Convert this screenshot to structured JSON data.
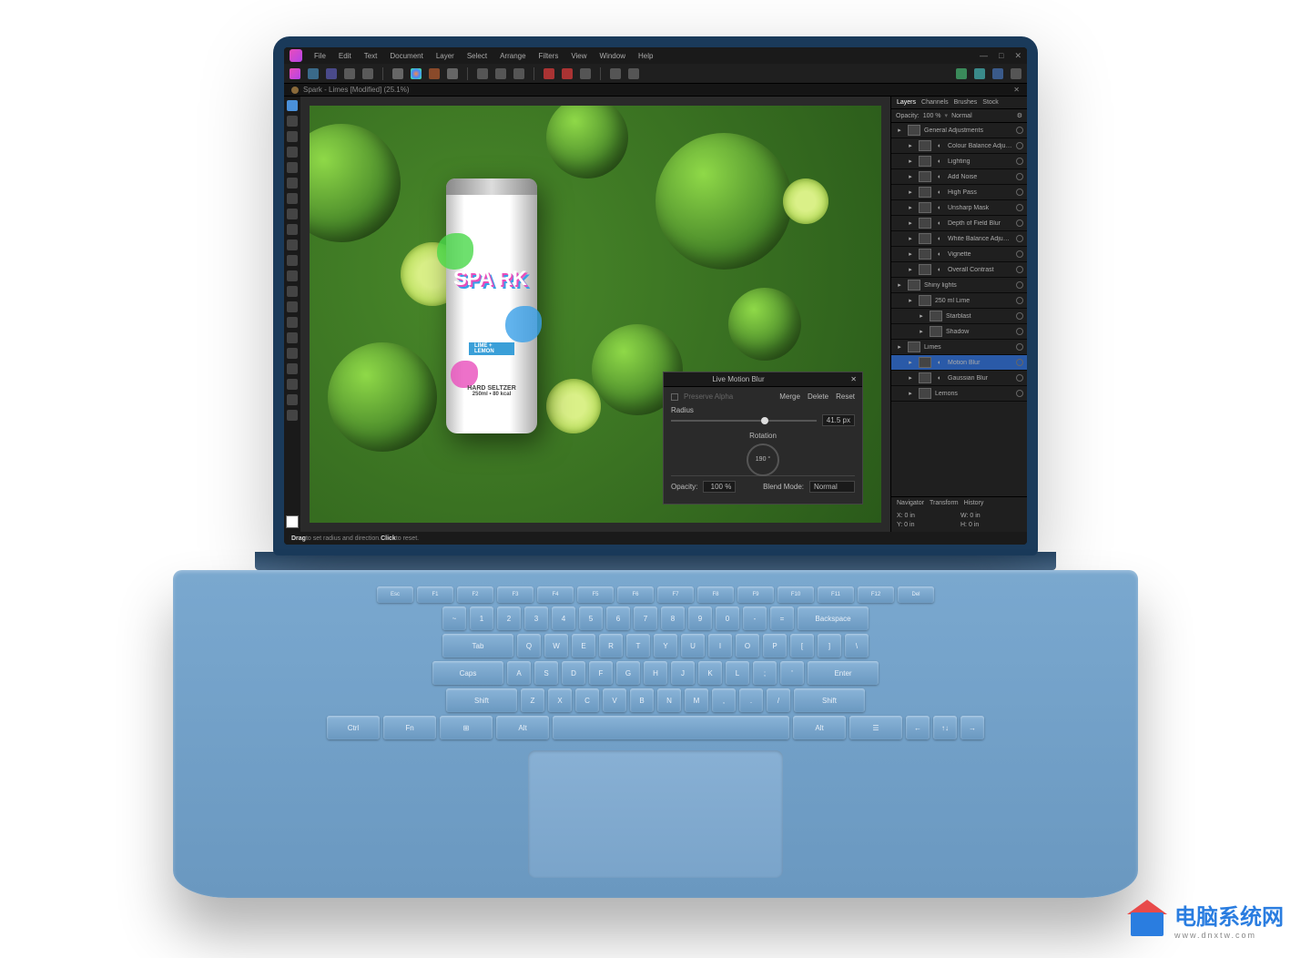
{
  "menubar": [
    "File",
    "Edit",
    "Text",
    "Document",
    "Layer",
    "Select",
    "Arrange",
    "Filters",
    "View",
    "Window",
    "Help"
  ],
  "doc_title": "Spark - Limes [Modified] (25.1%)",
  "panel": {
    "tabs": [
      "Layers",
      "Channels",
      "Brushes",
      "Stock"
    ],
    "opacity_label": "Opacity:",
    "opacity_value": "100 %",
    "blend": "Normal"
  },
  "layers": [
    {
      "name": "General Adjustments",
      "type": "group"
    },
    {
      "name": "Colour Balance Adjustme",
      "type": "adj",
      "indent": 1
    },
    {
      "name": "Lighting",
      "type": "adj",
      "indent": 1
    },
    {
      "name": "Add Noise",
      "type": "adj",
      "indent": 1
    },
    {
      "name": "High Pass",
      "type": "adj",
      "indent": 1
    },
    {
      "name": "Unsharp Mask",
      "type": "adj",
      "indent": 1
    },
    {
      "name": "Depth of Field Blur",
      "type": "adj",
      "indent": 1
    },
    {
      "name": "White Balance Adjustment",
      "type": "adj",
      "indent": 1
    },
    {
      "name": "Vignette",
      "type": "adj",
      "indent": 1
    },
    {
      "name": "Overall Contrast",
      "type": "adj",
      "indent": 1
    },
    {
      "name": "Shiny lights",
      "type": "group"
    },
    {
      "name": "250 ml Lime",
      "type": "img",
      "indent": 1
    },
    {
      "name": "Starblast",
      "type": "img",
      "indent": 2
    },
    {
      "name": "Shadow",
      "type": "fx",
      "indent": 2
    },
    {
      "name": "Limes",
      "type": "group"
    },
    {
      "name": "Motion Blur",
      "type": "adj",
      "indent": 1,
      "selected": true
    },
    {
      "name": "Gaussian Blur",
      "type": "adj",
      "indent": 1
    },
    {
      "name": "Lemons",
      "type": "img",
      "indent": 1
    }
  ],
  "bottom_tabs": [
    "Navigator",
    "Transform",
    "History"
  ],
  "transform": {
    "x": "X: 0 in",
    "y": "Y: 0 in",
    "w": "W: 0 in",
    "h": "H: 0 in"
  },
  "dialog": {
    "title": "Live Motion Blur",
    "preserve": "Preserve Alpha",
    "actions": [
      "Merge",
      "Delete",
      "Reset"
    ],
    "radius_label": "Radius",
    "radius_value": "41.5 px",
    "rotation_label": "Rotation",
    "rotation_value": "190 °",
    "opacity_label": "Opacity:",
    "opacity_value": "100 %",
    "blend_label": "Blend Mode:",
    "blend_value": "Normal"
  },
  "status": {
    "drag": "Drag",
    "drag_txt": " to set radius and direction. ",
    "click": "Click",
    "click_txt": " to reset."
  },
  "can": {
    "brand": "SPA\nRK",
    "tag": "LIME + LEMON",
    "sub": "HARD SELTZER",
    "vol": "250ml • 80 kcal"
  },
  "keyboard": {
    "fn": [
      "Esc",
      "F1",
      "F2",
      "F3",
      "F4",
      "F5",
      "F6",
      "F7",
      "F8",
      "F9",
      "F10",
      "F11",
      "F12",
      "Del"
    ],
    "r1": [
      "~",
      "1",
      "2",
      "3",
      "4",
      "5",
      "6",
      "7",
      "8",
      "9",
      "0",
      "-",
      "=",
      "Backspace"
    ],
    "r2": [
      "Tab",
      "Q",
      "W",
      "E",
      "R",
      "T",
      "Y",
      "U",
      "I",
      "O",
      "P",
      "[",
      "]",
      "\\"
    ],
    "r3": [
      "Caps",
      "A",
      "S",
      "D",
      "F",
      "G",
      "H",
      "J",
      "K",
      "L",
      ";",
      "'",
      "Enter"
    ],
    "r4": [
      "Shift",
      "Z",
      "X",
      "C",
      "V",
      "B",
      "N",
      "M",
      ",",
      ".",
      "/",
      "Shift"
    ],
    "r5": [
      "Ctrl",
      "Fn",
      "⊞",
      "Alt",
      " ",
      "Alt",
      "☰",
      "←",
      "↑↓",
      "→"
    ]
  },
  "watermark": {
    "text": "电脑系统网",
    "sub": "www.dnxtw.com"
  }
}
